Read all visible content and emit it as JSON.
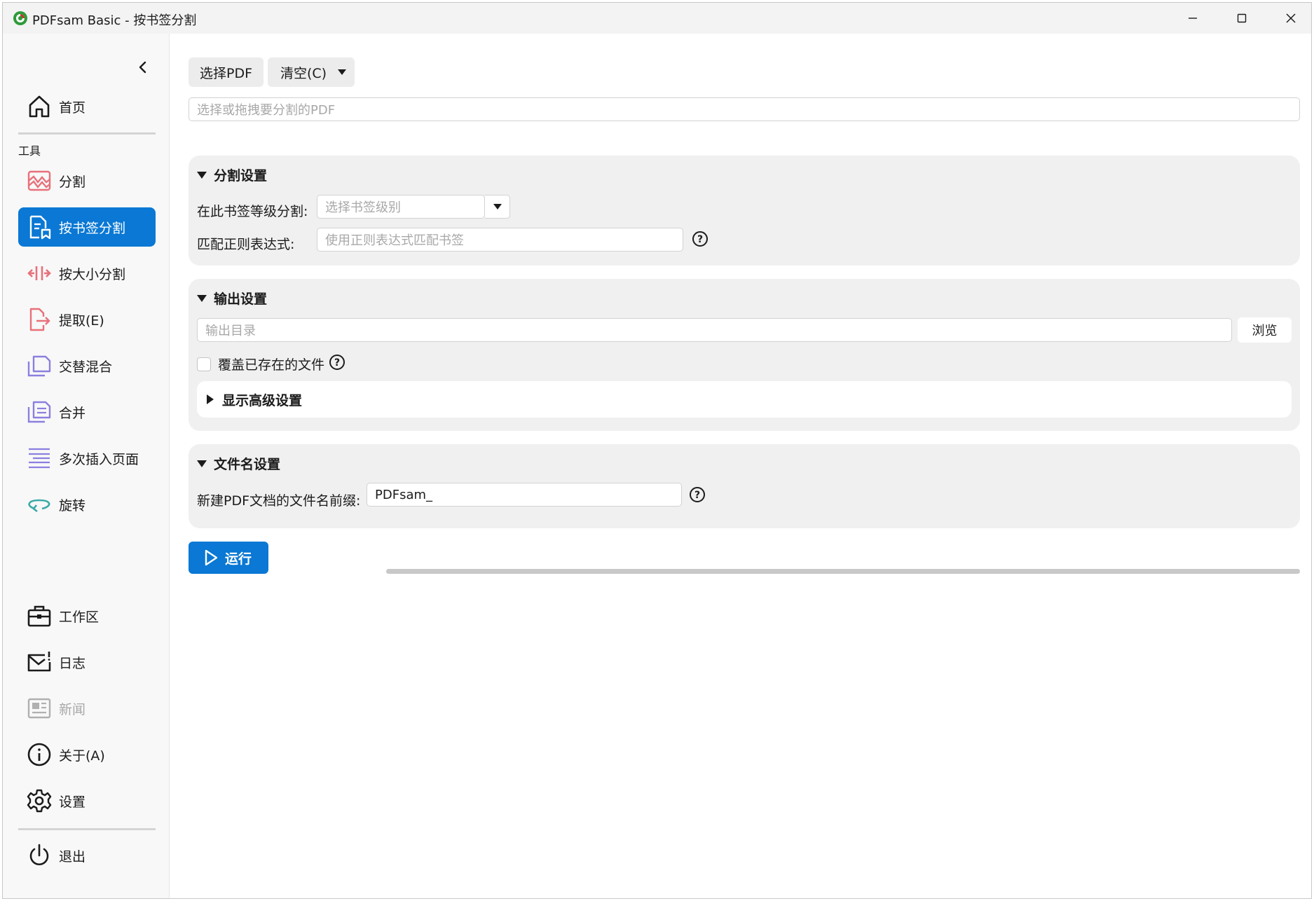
{
  "window": {
    "title": "PDFsam Basic - 按书签分割",
    "controls": [
      "minimize-icon",
      "maximize-icon",
      "close-icon"
    ]
  },
  "sidebar": {
    "collapse_icon": "chevron-left-icon",
    "home": {
      "label": "首页",
      "icon": "home-icon"
    },
    "tools_label": "工具",
    "tools": [
      {
        "label": "分割",
        "icon": "split-icon",
        "active": false
      },
      {
        "label": "按书签分割",
        "icon": "bookmark-split-icon",
        "active": true
      },
      {
        "label": "按大小分割",
        "icon": "size-split-icon",
        "active": false
      },
      {
        "label": "提取(E)",
        "icon": "extract-icon",
        "active": false
      },
      {
        "label": "交替混合",
        "icon": "alternate-mix-icon",
        "active": false
      },
      {
        "label": "合并",
        "icon": "merge-icon",
        "active": false
      },
      {
        "label": "多次插入页面",
        "icon": "insert-pages-icon",
        "active": false
      },
      {
        "label": "旋转",
        "icon": "rotate-icon",
        "active": false
      }
    ],
    "bottom": [
      {
        "label": "工作区",
        "icon": "workspace-icon"
      },
      {
        "label": "日志",
        "icon": "log-icon"
      },
      {
        "label": "新闻",
        "icon": "news-icon",
        "disabled": true
      },
      {
        "label": "关于(A)",
        "icon": "info-icon"
      },
      {
        "label": "设置",
        "icon": "gear-icon"
      }
    ],
    "exit": {
      "label": "退出",
      "icon": "power-icon"
    }
  },
  "toolbar": {
    "select_pdf_label": "选择PDF",
    "clear_label": "清空(C)"
  },
  "file_input": {
    "placeholder": "选择或拖拽要分割的PDF"
  },
  "split_settings": {
    "title": "分割设置",
    "level_label": "在此书签等级分割:",
    "level_placeholder": "选择书签级别",
    "regex_label": "匹配正则表达式:",
    "regex_placeholder": "使用正则表达式匹配书签"
  },
  "output_settings": {
    "title": "输出设置",
    "dir_placeholder": "输出目录",
    "browse_label": "浏览",
    "overwrite_label": "覆盖已存在的文件",
    "overwrite_checked": false,
    "advanced_label": "显示高级设置"
  },
  "filename_settings": {
    "title": "文件名设置",
    "prefix_label": "新建PDF文档的文件名前缀:",
    "prefix_value": "PDFsam_"
  },
  "run": {
    "label": "运行"
  },
  "progress": {
    "value": 0
  },
  "colors": {
    "accent": "#0a78d4",
    "icon_red": "#e8707a",
    "icon_purple": "#8b7fe0",
    "icon_teal": "#3aaaa6"
  }
}
